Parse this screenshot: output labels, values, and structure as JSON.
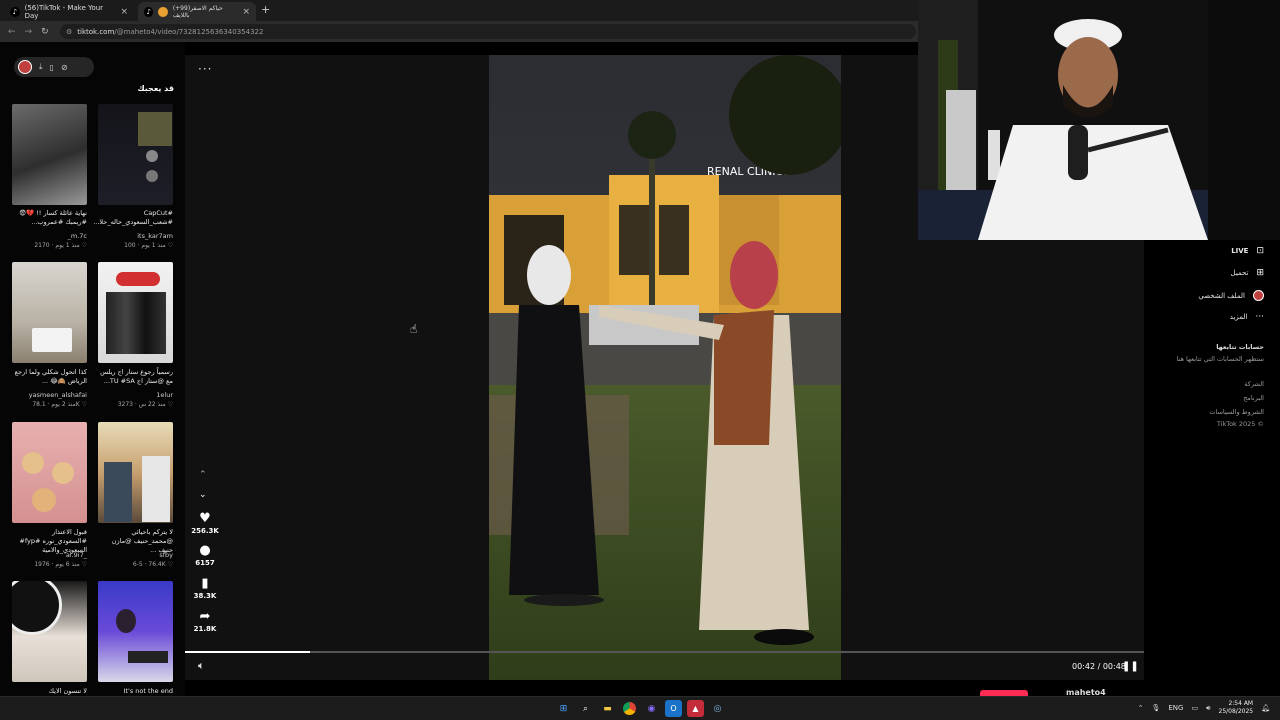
{
  "browser": {
    "tabs": [
      {
        "label": "(56)TikTok - Make Your Day",
        "active": false
      },
      {
        "label": "(+99)حياكم الاصفر باللايف",
        "active": true
      }
    ],
    "new_tab": "+",
    "url_host": "tiktok.com",
    "url_path": "/@maheto4/video/7328125636340354322"
  },
  "left": {
    "heading": "قد يعجبك",
    "items": [
      {
        "caption": "نهاية عائلة كسار !! 💔😨 #ريمبك #عمروب...",
        "author": "_m.7c",
        "views": "2170",
        "age": "منذ 1 يوم"
      },
      {
        "caption": "#CapCut #شعب_السعودي_حاله_حلا...",
        "author": "its_kar7am",
        "views": "100",
        "age": "منذ 1 يوم"
      },
      {
        "caption": "كذا اتحول شكلي ولما ارجع الرياض 🙈😂 ...",
        "author": "yasmeen_alshafai",
        "views": "78.1K",
        "age": "منذ 2 يوم"
      },
      {
        "caption": "رسمياً رجوع ستار اج ريلس مع @ستار اج TU #SA...",
        "author": "1elur",
        "views": "3273",
        "age": "منذ 22 س"
      },
      {
        "caption": "قبول الاعتذار #السعودي_نوره #fyp# السعودي_والامية",
        "author": "al.9i7_",
        "views": "1976",
        "age": "منذ 6 يوم"
      },
      {
        "caption": "لا يتركم باحيائي @محمد_حنيف @مازن حنيف ...",
        "author": "sfby",
        "views": "76.4K",
        "age": "6-5"
      },
      {
        "caption": "لا تنسون الايك والسبسكرايب",
        "author": "",
        "views": "",
        "age": ""
      },
      {
        "caption": "It's not the end",
        "author": "",
        "views": "",
        "age": ""
      }
    ]
  },
  "player": {
    "likes": "256.3K",
    "comments": "6157",
    "saves": "38.3K",
    "shares": "21.8K",
    "time": "00:42 / 00:48",
    "progress": 0.13
  },
  "right": {
    "nav": [
      {
        "label": "LIVE",
        "icon": "live-icon"
      },
      {
        "label": "تحميل",
        "icon": "upload-icon"
      },
      {
        "label": "الملف الشخصي",
        "icon": "profile-icon"
      },
      {
        "label": "المزيد",
        "icon": "more-icon"
      }
    ],
    "following_title": "حسابات تتابعها",
    "following_sub": "ستظهر الحسابات التي تتابعها هنا",
    "footer": [
      "الشركة",
      "البرنامج",
      "الشروط والسياسات",
      "TikTok 2025 ©"
    ]
  },
  "bottom": {
    "username": "maheto4"
  },
  "taskbar": {
    "lang": "ENG",
    "time": "2:54 AM",
    "date": "25/08/2025"
  }
}
